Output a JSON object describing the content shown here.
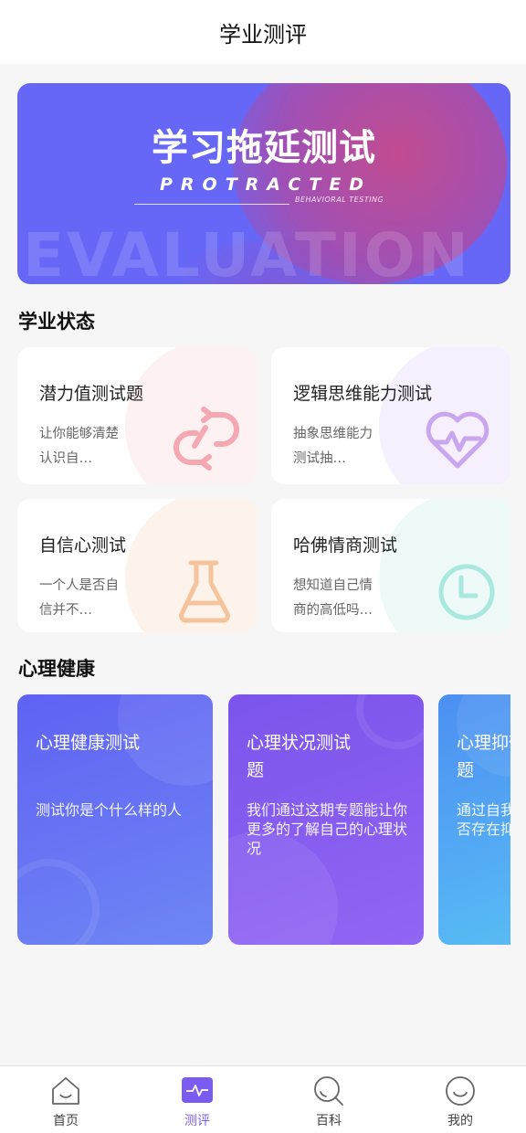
{
  "header": {
    "title": "学业测评"
  },
  "banner": {
    "title": "学习拖延测试",
    "subtitle": "PROTRACTED",
    "tagline": "BEHAVIORAL TESTING",
    "watermark": "EVALUATION"
  },
  "academic": {
    "section_title": "学业状态",
    "cards": [
      {
        "title": "潜力值测试题",
        "desc": "让你能够清楚认识自…",
        "icon": "link-arrows-icon",
        "color": "#f6a8b2",
        "tint": "#fdf1f2"
      },
      {
        "title": "逻辑思维能力测试",
        "desc": "抽象思维能力测试抽…",
        "icon": "heartbeat-icon",
        "color": "#c9a6ee",
        "tint": "#f6effd"
      },
      {
        "title": "自信心测试",
        "desc": "一个人是否自信并不…",
        "icon": "flask-icon",
        "color": "#f5c49c",
        "tint": "#fdf3eb"
      },
      {
        "title": "哈佛情商测试",
        "desc": "想知道自己情商的高低吗…",
        "icon": "clock-icon",
        "color": "#a9e8de",
        "tint": "#eefaf8"
      }
    ]
  },
  "mental": {
    "section_title": "心理健康",
    "cards": [
      {
        "title": "心理健康测试",
        "desc": "测试你是个什么样的人",
        "from": "#5f62f2",
        "to": "#6e86f5"
      },
      {
        "title": "心理状况测试题",
        "desc": "我们通过这期专题能让你更多的了解自己的心理状况",
        "from": "#7b54ec",
        "to": "#9166f3"
      },
      {
        "title": "心理抑郁测试题",
        "desc": "通过自我测试了解自己是否存在抑郁以及严重程度",
        "from": "#4c8ff2",
        "to": "#5ac2f5"
      }
    ]
  },
  "tabbar": {
    "active_color": "#7b5cf0",
    "items": [
      {
        "label": "首页",
        "icon": "home-icon"
      },
      {
        "label": "测评",
        "icon": "pulse-icon"
      },
      {
        "label": "百科",
        "icon": "search-icon"
      },
      {
        "label": "我的",
        "icon": "smile-icon"
      }
    ]
  }
}
